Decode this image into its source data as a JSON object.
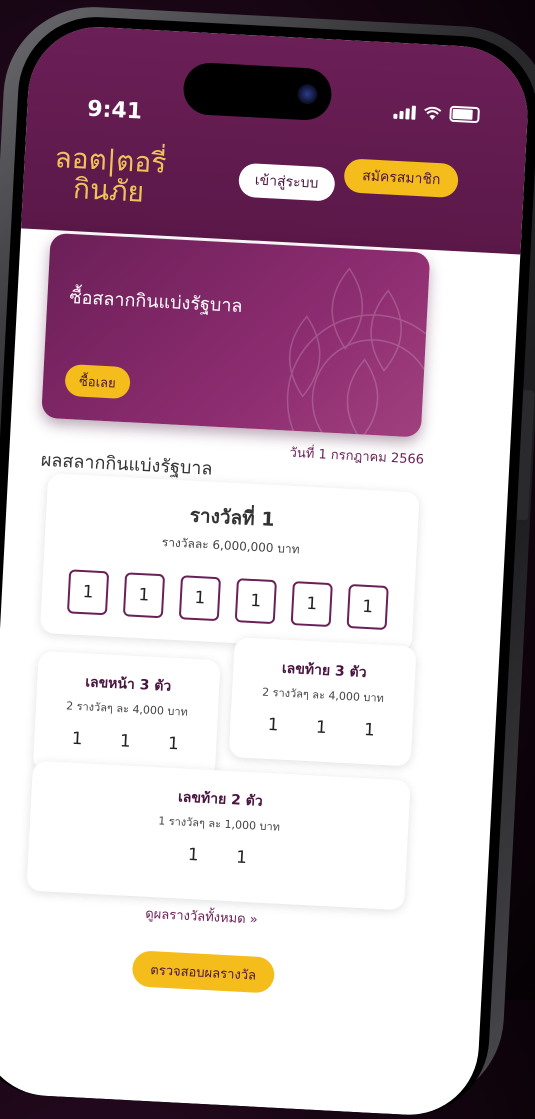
{
  "status_bar": {
    "time": "9:41"
  },
  "app": {
    "logo_line1": "ลอต|ตอรี่",
    "logo_line2": "กินภัย"
  },
  "header": {
    "login_label": "เข้าสู่ระบบ",
    "register_label": "สมัครสมาชิก"
  },
  "banner": {
    "title": "ซื้อสลากกินแบ่งรัฐบาล",
    "buy_label": "ซื้อเลย"
  },
  "results": {
    "title": "ผลสลากกินแบ่งรัฐบาล",
    "date": "วันที่ 1 กรกฎาคม 2566",
    "first_prize": {
      "title": "รางวัลที่ 1",
      "amount": "รางวัลละ 6,000,000 บาท",
      "digits": [
        "1",
        "1",
        "1",
        "1",
        "1",
        "1"
      ]
    },
    "front3": {
      "title": "เลขหน้า 3 ตัว",
      "amount": "2 รางวัลๆ ละ 4,000 บาท",
      "number": "1 1 1"
    },
    "back3": {
      "title": "เลขท้าย 3 ตัว",
      "amount": "2 รางวัลๆ ละ 4,000 บาท",
      "number": "1 1 1"
    },
    "back2": {
      "title": "เลขท้าย 2 ตัว",
      "amount": "1 รางวัลๆ ละ 1,000 บาท",
      "number": "1 1"
    },
    "view_all_label": "ดูผลรางวัลทั้งหมด »",
    "check_label": "ตรวจสอบผลรางวัล"
  },
  "colors": {
    "brand_purple": "#6b1f57",
    "accent_yellow": "#f4bd1c",
    "logo_gold": "#f0c35a"
  }
}
